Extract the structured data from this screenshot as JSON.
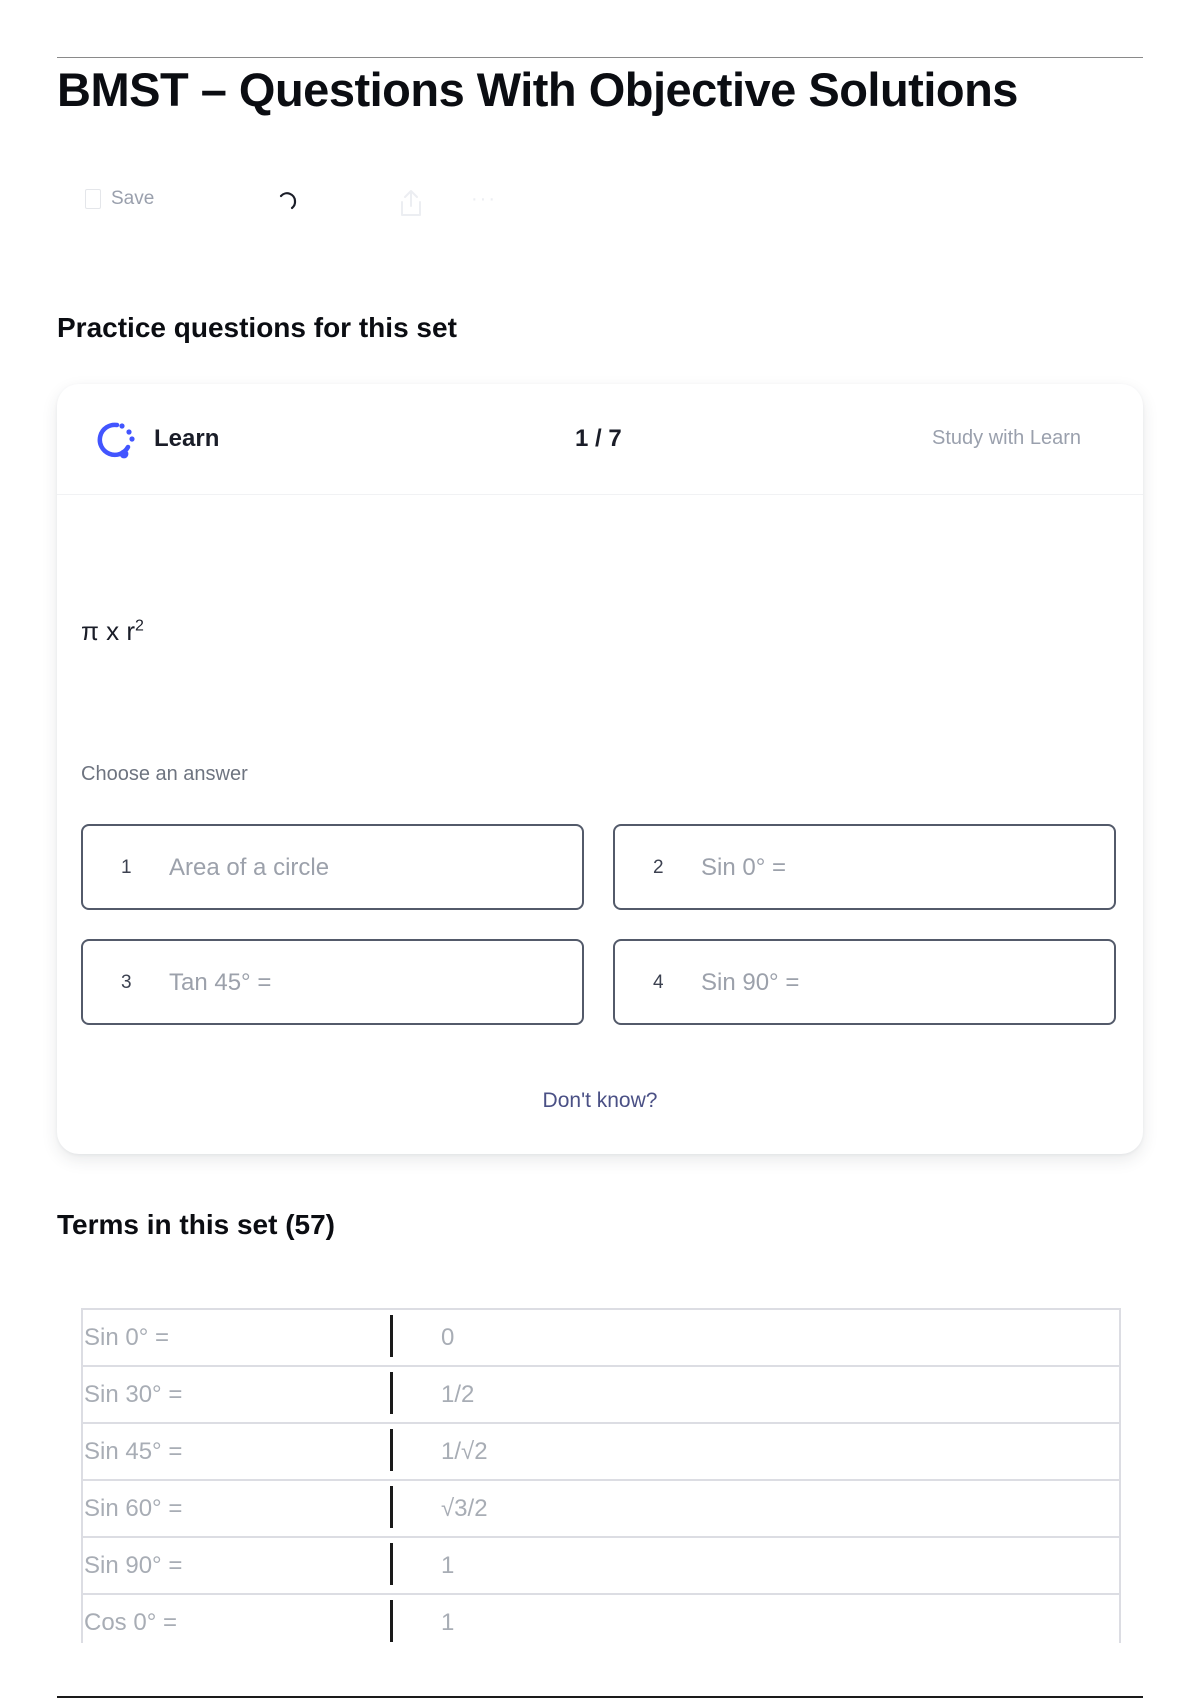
{
  "page": {
    "title": "BMST – Questions With Objective Solutions"
  },
  "toolbar": {
    "save_label": "Save",
    "more_label": "···"
  },
  "practice": {
    "heading": "Practice questions for this set",
    "mode_label": "Learn",
    "progress": "1 / 7",
    "study_link": "Study with Learn",
    "question_base": "π x r",
    "question_exponent": "2",
    "choose_label": "Choose an answer",
    "options": [
      {
        "number": "1",
        "text": "Area of a circle"
      },
      {
        "number": "2",
        "text": "Sin 0° ="
      },
      {
        "number": "3",
        "text": "Tan 45° ="
      },
      {
        "number": "4",
        "text": "Sin 90° ="
      }
    ],
    "dont_know": "Don't know?"
  },
  "terms": {
    "heading": "Terms in this set (57)",
    "rows": [
      {
        "term": "Sin 0° =",
        "definition": "0"
      },
      {
        "term": "Sin 30° =",
        "definition": "1/2"
      },
      {
        "term": "Sin 45° =",
        "definition": "1/√2"
      },
      {
        "term": "Sin 60° =",
        "definition": "√3/2"
      },
      {
        "term": "Sin 90° =",
        "definition": "1"
      },
      {
        "term": "Cos 0° =",
        "definition": "1"
      }
    ]
  },
  "colors": {
    "learn_icon": "#4255ff",
    "option_border": "#535a6a",
    "dont_know": "#4a5085"
  }
}
